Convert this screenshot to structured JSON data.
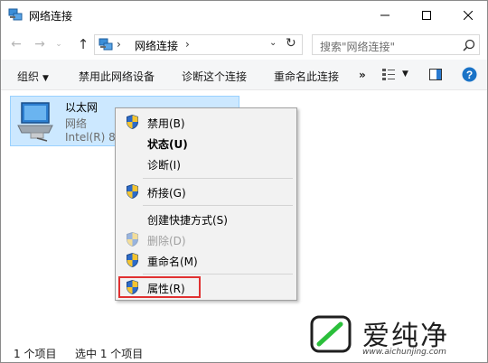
{
  "window": {
    "title": "网络连接",
    "controls": {
      "minimize": "minimize-icon",
      "maximize": "maximize-icon",
      "close": "close-icon"
    }
  },
  "nav": {
    "back": "←",
    "forward": "→",
    "recent": "⌄",
    "up": "↑",
    "address_separator": "›",
    "address_path": "网络连接",
    "search_placeholder": "搜索\"网络连接\""
  },
  "commands": {
    "organize": "组织",
    "disable_device": "禁用此网络设备",
    "diagnose": "诊断这个连接",
    "rename": "重命名此连接",
    "more": "»"
  },
  "item": {
    "name": "以太网",
    "status": "网络",
    "device": "Intel(R) 82"
  },
  "context_menu": {
    "items": [
      {
        "label": "禁用(B)",
        "icon": "shield-icon"
      },
      {
        "label": "状态(U)"
      },
      {
        "label": "诊断(I)"
      },
      {
        "label": "桥接(G)",
        "icon": "shield-icon"
      },
      {
        "label": "创建快捷方式(S)"
      },
      {
        "label": "删除(D)",
        "icon": "shield-icon"
      },
      {
        "label": "重命名(M)",
        "icon": "shield-icon"
      },
      {
        "label": "属性(R)",
        "icon": "shield-icon"
      }
    ]
  },
  "status": {
    "count": "1 个项目",
    "selected": "选中 1 个项目"
  },
  "watermark": {
    "brand": "爱纯净",
    "url": "www.aichunjing.com"
  },
  "colors": {
    "selection_bg": "#cce8ff",
    "highlight_border": "#e03131",
    "help_blue": "#1a73c7"
  }
}
